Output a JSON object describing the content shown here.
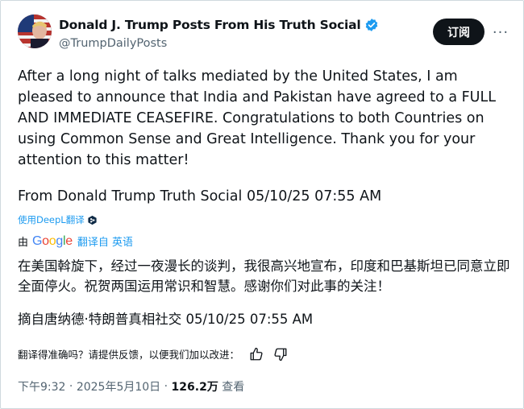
{
  "author": {
    "display_name": "Donald J. Trump Posts From His Truth Social",
    "handle": "@TrumpDailyPosts",
    "verified": true
  },
  "actions": {
    "follow_label": "订阅",
    "more_label": "···"
  },
  "post": {
    "text": "After a long night of talks mediated by the United States, I am pleased to announce that India and Pakistan have agreed to a FULL AND IMMEDIATE CEASEFIRE. Congratulations to both Countries on using Common Sense and Great Intelligence. Thank you for your attention to this matter!",
    "source_line": "From Donald Trump Truth Social 05/10/25 07:55 AM"
  },
  "translation": {
    "deepl_link": "使用DeepL翻译",
    "by_prefix": "由",
    "google_logo": "Google",
    "translated_from": "翻译自 英语",
    "text": "在美国斡旋下，经过一夜漫长的谈判，我很高兴地宣布，印度和巴基斯坦已同意立即全面停火。祝贺两国运用常识和智慧。感谢你们对此事的关注！",
    "source_line": "摘自唐纳德·特朗普真相社交 05/10/25 07:55 AM",
    "feedback_prompt": "翻译得准确吗？请提供反馈，以便我们加以改进："
  },
  "meta": {
    "time": "下午9:32",
    "date": "2025年5月10日",
    "views_count": "126.2万",
    "views_label": "查看"
  },
  "colors": {
    "link": "#1d9bf0",
    "text": "#0f1419",
    "secondary": "#536471"
  }
}
